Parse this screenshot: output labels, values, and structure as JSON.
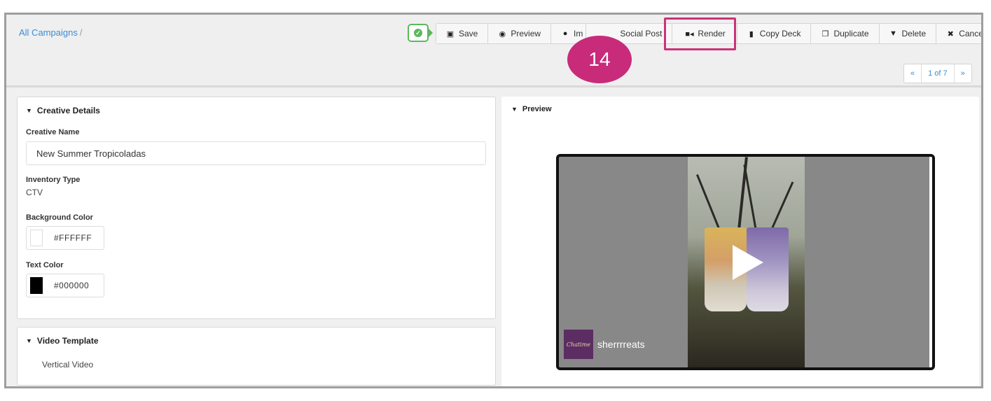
{
  "breadcrumb": {
    "root": "All Campaigns",
    "separator": "/"
  },
  "toolbar": {
    "buttons": [
      {
        "label": "Save",
        "icon": "floppy-icon"
      },
      {
        "label": "Preview",
        "icon": "eye-icon"
      },
      {
        "label": "Im",
        "icon": "circle-arrow-icon"
      },
      {
        "label": "Social Post",
        "icon": ""
      },
      {
        "label": "Render",
        "icon": "video-camera-icon"
      },
      {
        "label": "Copy Deck",
        "icon": "clipboard-icon"
      },
      {
        "label": "Duplicate",
        "icon": "copy-icon"
      },
      {
        "label": "Delete",
        "icon": "trash-icon"
      },
      {
        "label": "Cancel",
        "icon": "x-icon"
      }
    ]
  },
  "callout": {
    "step": "14"
  },
  "pager": {
    "prev": "«",
    "current": "1 of 7",
    "next": "»"
  },
  "creative_details": {
    "title": "Creative Details",
    "creative_name_label": "Creative Name",
    "creative_name_value": "New Summer Tropicoladas",
    "inventory_type_label": "Inventory Type",
    "inventory_type_value": "CTV",
    "background_color_label": "Background Color",
    "background_color_value": "#FFFFFF",
    "text_color_label": "Text Color",
    "text_color_value": "#000000"
  },
  "video_template": {
    "title": "Video Template",
    "value": "Vertical Video"
  },
  "preview": {
    "title": "Preview",
    "brand_logo_text": "Chatime",
    "brand_name": "sherrrreats"
  },
  "colors": {
    "accent": "#3a8dd6",
    "highlight": "#c9337a",
    "status": "#5cb85c"
  }
}
